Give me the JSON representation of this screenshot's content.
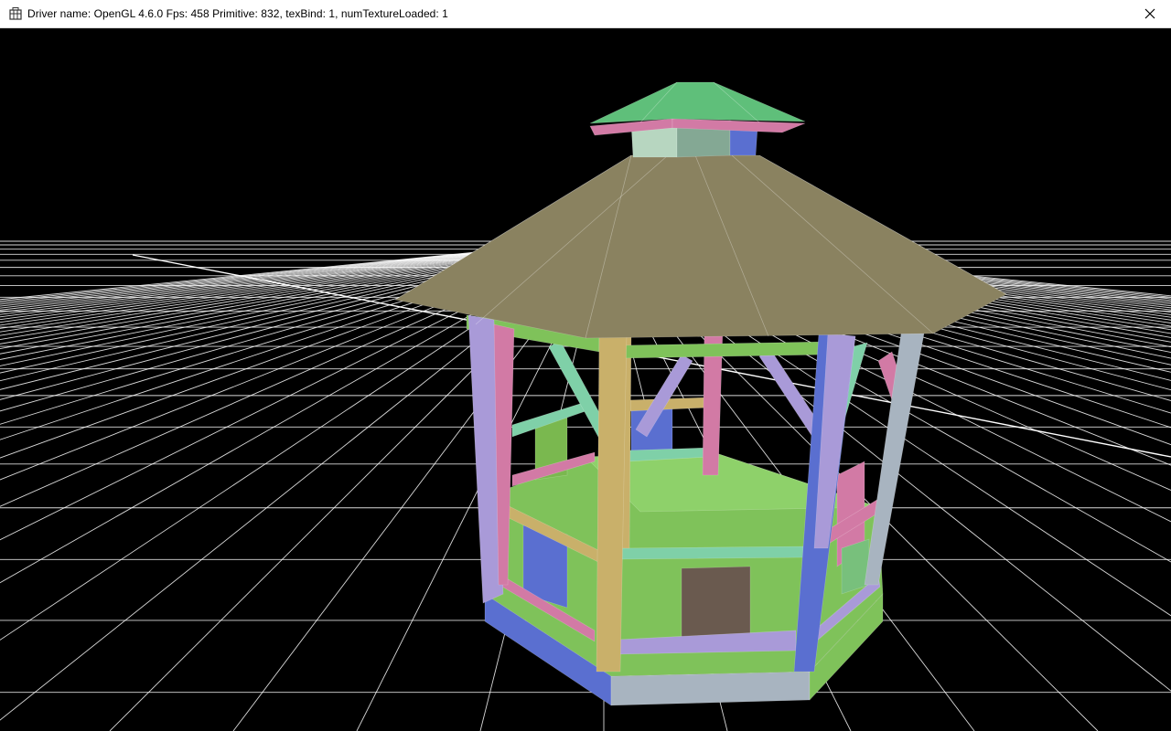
{
  "window": {
    "title": "Driver name: OpenGL 4.6.0 Fps: 458 Primitive: 832, texBind: 1, numTextureLoaded: 1",
    "icons": {
      "app": "app-window-icon",
      "close": "close-icon"
    }
  },
  "scene": {
    "background": "#000000",
    "grid_color": "#ffffff",
    "colors": {
      "roof": "#8a8260",
      "cap": "#5fbf7a",
      "floor": "#7fc25a",
      "blue": "#5a6fd0",
      "lavender": "#a99ad8",
      "pink": "#d27aa5",
      "mint": "#7fd0a8",
      "tan": "#c9b06a",
      "brown": "#6a5a4f",
      "gray_blue": "#a8b4c0"
    }
  }
}
